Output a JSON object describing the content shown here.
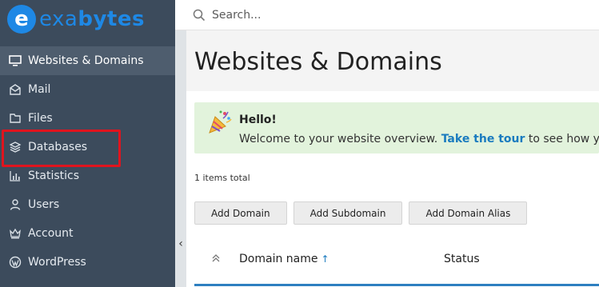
{
  "brand": {
    "mark": "e",
    "text_a": "exa",
    "text_b": "bytes",
    "color": "#1e88e5"
  },
  "search": {
    "placeholder": "Search..."
  },
  "sidebar": {
    "items": [
      {
        "label": "Websites & Domains",
        "icon": "monitor-icon",
        "active": true
      },
      {
        "label": "Mail",
        "icon": "mail-icon"
      },
      {
        "label": "Files",
        "icon": "folder-icon"
      },
      {
        "label": "Databases",
        "icon": "layers-icon",
        "highlighted": true
      },
      {
        "label": "Statistics",
        "icon": "bar-chart-icon"
      },
      {
        "label": "Users",
        "icon": "user-icon"
      },
      {
        "label": "Account",
        "icon": "crown-icon"
      },
      {
        "label": "WordPress",
        "icon": "wordpress-icon"
      }
    ]
  },
  "main": {
    "title": "Websites & Domains",
    "welcome": {
      "title": "Hello!",
      "text_before": "Welcome to your website overview. ",
      "link": "Take the tour",
      "text_after": " to see how you can"
    },
    "items_total": "1 items total",
    "buttons": {
      "add_domain": "Add Domain",
      "add_subdomain": "Add Subdomain",
      "add_domain_alias": "Add Domain Alias"
    },
    "table": {
      "col_domain": "Domain name",
      "col_status": "Status"
    }
  },
  "colors": {
    "sidebar": "#3c4b5c",
    "active": "#4e5d6e",
    "highlight": "#e0141e",
    "link": "#1a7bbf",
    "welcome_bg": "#e2f3dc"
  }
}
